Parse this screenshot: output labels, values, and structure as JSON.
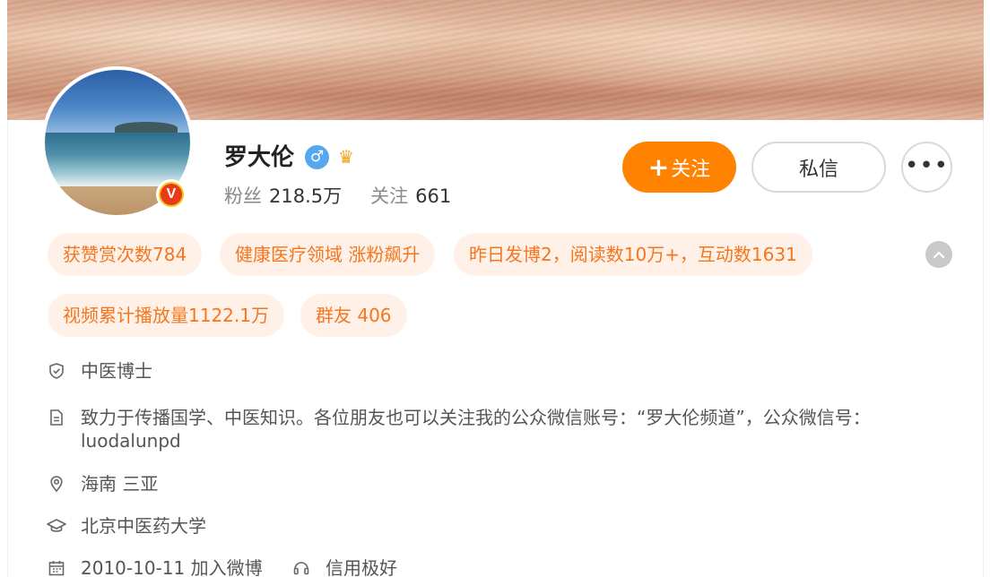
{
  "profile": {
    "name": "罗大伦",
    "gender_symbol": "♂",
    "crown_symbol": "♛",
    "verified_symbol": "V",
    "fans_label": "粉丝",
    "fans_count": "218.5万",
    "following_label": "关注",
    "following_count": "661"
  },
  "actions": {
    "follow_plus": "+",
    "follow_label": "关注",
    "message_label": "私信",
    "more_label": "•••"
  },
  "tags": [
    {
      "label": "获赞赏次数784"
    },
    {
      "label": "健康医疗领域 涨粉飙升"
    },
    {
      "label": "昨日发博2，阅读数10万+，互动数1631"
    },
    {
      "label": "视频累计播放量1122.1万"
    },
    {
      "label": "群友 406"
    }
  ],
  "collapse_icon": "chevron-up-icon",
  "info": {
    "title": "中医博士",
    "bio_line1": "致力于传播国学、中医知识。各位朋友也可以关注我的公众微信账号：“罗大伦频道”，公众微信号：",
    "bio_line2": "luodalunpd",
    "location": "海南 三亚",
    "school": "北京中医药大学",
    "joined": "2010-10-11 加入微博",
    "credit": "信用极好"
  },
  "colors": {
    "accent": "#ff8200",
    "tag_bg": "#fff1e8",
    "tag_text": "#f4761f"
  }
}
